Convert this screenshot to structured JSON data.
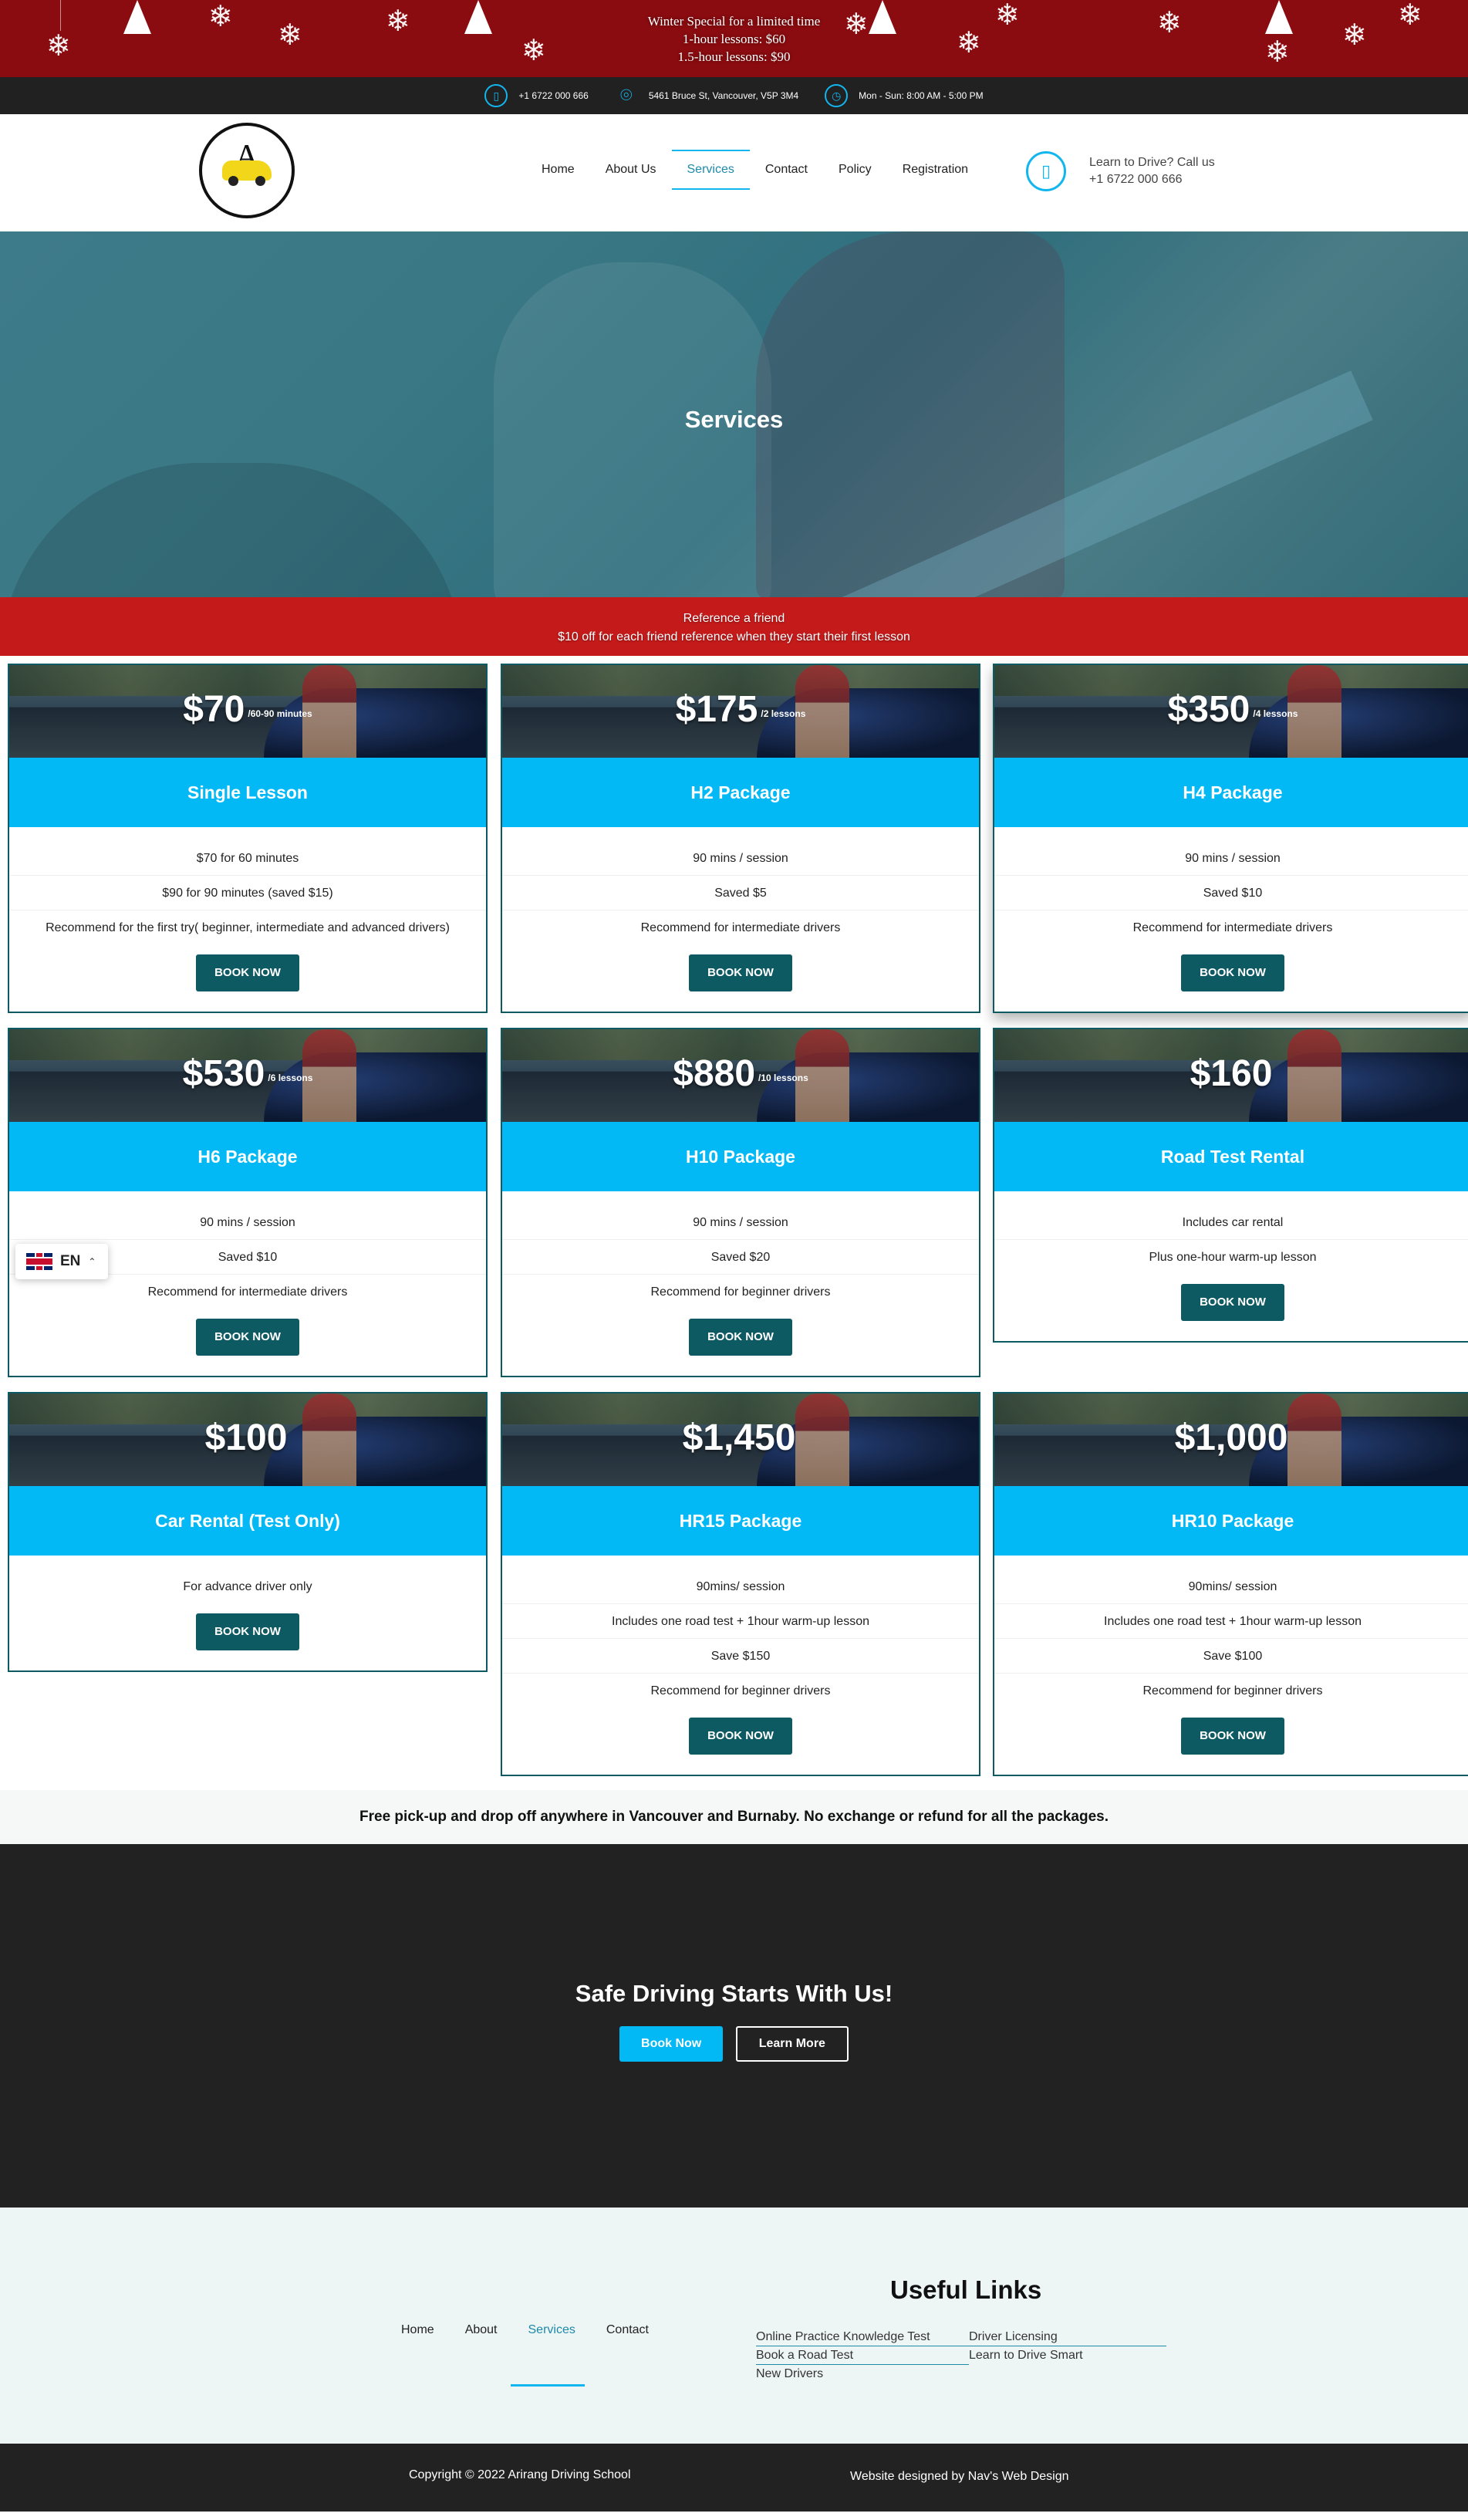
{
  "winter": {
    "line1": "Winter Special for a limited time",
    "line2": "1-hour lessons: $60",
    "line3": "1.5-hour lessons: $90"
  },
  "topbar": {
    "phone": "+1 6722 000 666",
    "address": "5461 Bruce St, Vancouver, V5P 3M4",
    "hours": "Mon - Sun: 8:00 AM - 5:00 PM"
  },
  "nav": {
    "items": [
      {
        "label": "Home"
      },
      {
        "label": "About Us"
      },
      {
        "label": "Services"
      },
      {
        "label": "Contact"
      },
      {
        "label": "Policy"
      },
      {
        "label": "Registration"
      }
    ],
    "active": "Services"
  },
  "callbox": {
    "line1": "Learn to Drive? Call us",
    "line2": "+1 6722 000 666"
  },
  "hero": {
    "title": "Services"
  },
  "referral": {
    "line1": "Reference a friend",
    "line2": "$10 off for each friend reference when they start their first lesson"
  },
  "cards": [
    {
      "price": "$70",
      "per": "/60-90 minutes",
      "title": "Single Lesson",
      "features": [
        "$70 for 60 minutes",
        "$90 for 90 minutes (saved $15)",
        "Recommend for the first try( beginner, intermediate and advanced drivers)"
      ],
      "button": "BOOK NOW"
    },
    {
      "price": "$175",
      "per": "/2 lessons",
      "title": "H2 Package",
      "features": [
        "90 mins / session",
        "Saved $5",
        "Recommend for intermediate drivers"
      ],
      "button": "BOOK NOW"
    },
    {
      "price": "$350",
      "per": "/4 lessons",
      "title": "H4 Package",
      "features": [
        "90 mins / session",
        "Saved $10",
        "Recommend for intermediate drivers"
      ],
      "button": "BOOK NOW"
    },
    {
      "price": "$530",
      "per": "/6 lessons",
      "title": "H6 Package",
      "features": [
        "90 mins / session",
        "Saved $10",
        "Recommend for intermediate drivers"
      ],
      "button": "BOOK NOW"
    },
    {
      "price": "$880",
      "per": "/10 lessons",
      "title": "H10 Package",
      "features": [
        "90 mins / session",
        "Saved $20",
        "Recommend for beginner drivers"
      ],
      "button": "BOOK NOW"
    },
    {
      "price": "$160",
      "per": "",
      "title": "Road Test Rental",
      "features": [
        "Includes car rental",
        "Plus one-hour warm-up lesson"
      ],
      "button": "BOOK NOW"
    },
    {
      "price": "$100",
      "per": "",
      "title": "Car Rental (Test Only)",
      "features": [
        "For advance driver only"
      ],
      "button": "BOOK NOW"
    },
    {
      "price": "$1,450",
      "per": "",
      "title": "HR15 Package",
      "features": [
        "90mins/ session",
        "Includes one road test + 1hour warm-up lesson",
        "Save $150",
        "Recommend for beginner drivers"
      ],
      "button": "BOOK NOW"
    },
    {
      "price": "$1,000",
      "per": "",
      "title": "HR10 Package",
      "features": [
        "90mins/ session",
        "Includes one road test + 1hour warm-up lesson",
        "Save $100",
        "Recommend for beginner drivers"
      ],
      "button": "BOOK NOW"
    }
  ],
  "language": {
    "code": "EN"
  },
  "notice": "Free pick-up and drop off anywhere in Vancouver and Burnaby. No exchange or refund for all the packages.",
  "cta": {
    "title": "Safe Driving Starts With Us!",
    "primary": "Book Now",
    "secondary": "Learn More"
  },
  "footer": {
    "nav": [
      {
        "label": "Home"
      },
      {
        "label": "About"
      },
      {
        "label": "Services"
      },
      {
        "label": "Contact"
      }
    ],
    "useful_title": "Useful Links",
    "links": [
      {
        "label": "Online Practice Knowledge Test"
      },
      {
        "label": "Driver Licensing"
      },
      {
        "label": "Book a Road Test"
      },
      {
        "label": "Learn to Drive Smart"
      },
      {
        "label": "New Drivers"
      }
    ],
    "copyright": "Copyright © 2022 Arirang Driving School",
    "designed": "Website designed  by Nav's Web Design"
  },
  "colors": {
    "accent": "#03b9f5",
    "dark_teal": "#0e5a63",
    "winter_red": "#8b0c10",
    "referral_red": "#c41a1a",
    "dark": "#222222"
  },
  "icons": [
    "phone-icon",
    "location-pin-icon",
    "clock-icon",
    "mobile-phone-icon",
    "snowflake-icon",
    "uk-flag-icon",
    "chevron-up-icon"
  ]
}
